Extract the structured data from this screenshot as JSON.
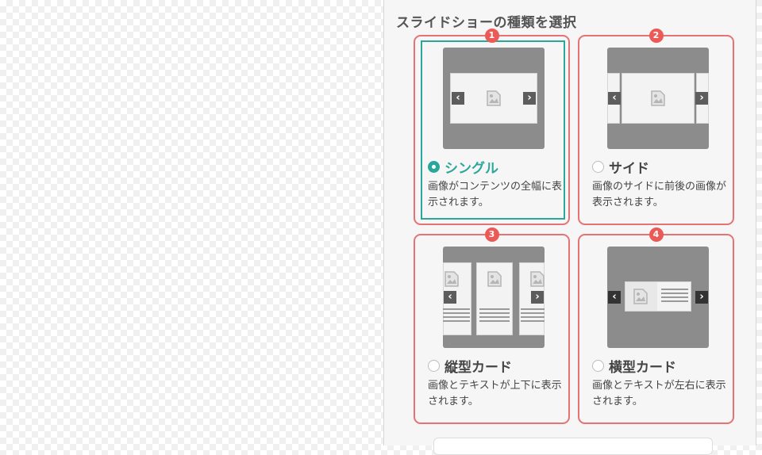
{
  "panel": {
    "title": "スライドショーの種類を選択",
    "options": [
      {
        "number": "1",
        "label": "シングル",
        "desc": "画像がコンテンツの全幅に表示されます。",
        "selected": true
      },
      {
        "number": "2",
        "label": "サイド",
        "desc": "画像のサイドに前後の画像が表示されます。",
        "selected": false
      },
      {
        "number": "3",
        "label": "縦型カード",
        "desc": "画像とテキストが上下に表示されます。",
        "selected": false
      },
      {
        "number": "4",
        "label": "横型カード",
        "desc": "画像とテキストが左右に表示されます。",
        "selected": false
      }
    ],
    "icons": {
      "prev": "‹",
      "next": "›"
    }
  },
  "colors": {
    "accent": "#2aa79b",
    "card_border": "#e57373",
    "badge": "#ec5a57"
  }
}
